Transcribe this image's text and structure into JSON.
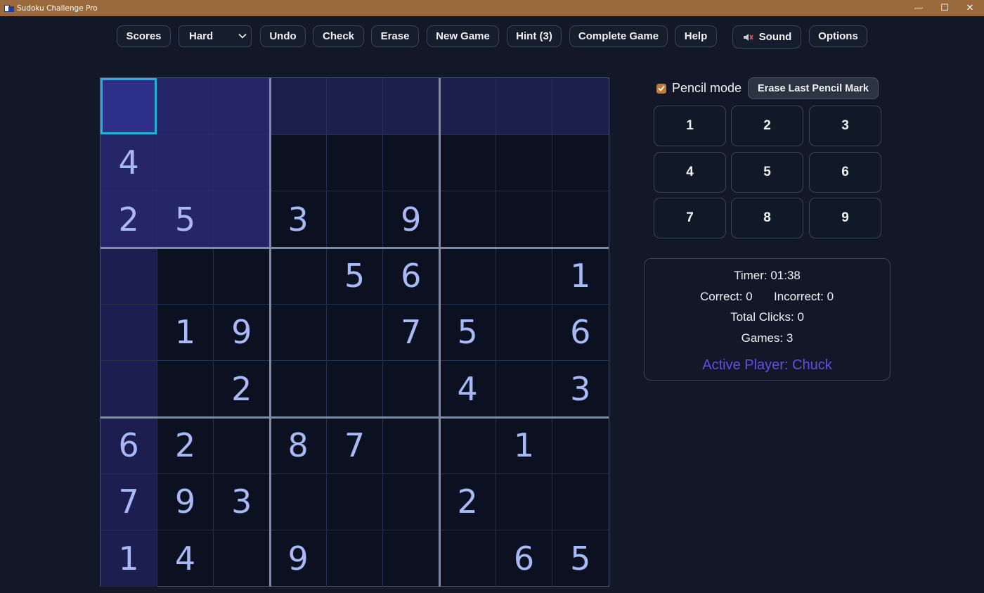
{
  "window": {
    "title": "Sudoku Challenge Pro",
    "controls": {
      "minimize": "—",
      "maximize": "☐",
      "close": "✕"
    }
  },
  "toolbar": {
    "scores": "Scores",
    "difficulty": "Hard",
    "undo": "Undo",
    "check": "Check",
    "erase": "Erase",
    "new_game": "New Game",
    "hint": "Hint (3)",
    "complete": "Complete Game",
    "help": "Help",
    "sound": "Sound",
    "options": "Options"
  },
  "pencil": {
    "label": "Pencil mode",
    "checked": true,
    "erase_last": "Erase Last Pencil Mark"
  },
  "numpad": [
    "1",
    "2",
    "3",
    "4",
    "5",
    "6",
    "7",
    "8",
    "9"
  ],
  "stats": {
    "timer": "Timer: 01:38",
    "correct": "Correct: 0",
    "incorrect": "Incorrect: 0",
    "clicks": "Total Clicks: 0",
    "games": "Games: 3",
    "player": "Active Player: Chuck"
  },
  "board": {
    "selected": {
      "row": 0,
      "col": 0
    },
    "cells": [
      [
        "",
        "",
        "",
        "",
        "",
        "",
        "",
        "",
        ""
      ],
      [
        "4",
        "",
        "",
        "",
        "",
        "",
        "",
        "",
        ""
      ],
      [
        "2",
        "5",
        "",
        "3",
        "",
        "9",
        "",
        "",
        ""
      ],
      [
        "",
        "",
        "",
        "",
        "5",
        "6",
        "",
        "",
        "1"
      ],
      [
        "",
        "1",
        "9",
        "",
        "",
        "7",
        "5",
        "",
        "6"
      ],
      [
        "",
        "",
        "2",
        "",
        "",
        "",
        "4",
        "",
        "3"
      ],
      [
        "6",
        "2",
        "",
        "8",
        "7",
        "",
        "",
        "1",
        ""
      ],
      [
        "7",
        "9",
        "3",
        "",
        "",
        "",
        "2",
        "",
        ""
      ],
      [
        "1",
        "4",
        "",
        "9",
        "",
        "",
        "",
        "6",
        "5"
      ]
    ]
  },
  "colors": {
    "accent_selected": "#1fb4d6",
    "highlight_row": "#1c1e4c",
    "highlight_col": "#1d1e50",
    "highlight_box": "#25266a",
    "highlight_selected": "#2e2f88",
    "player": "#6050e2",
    "checkbox": "#c07a3a"
  }
}
